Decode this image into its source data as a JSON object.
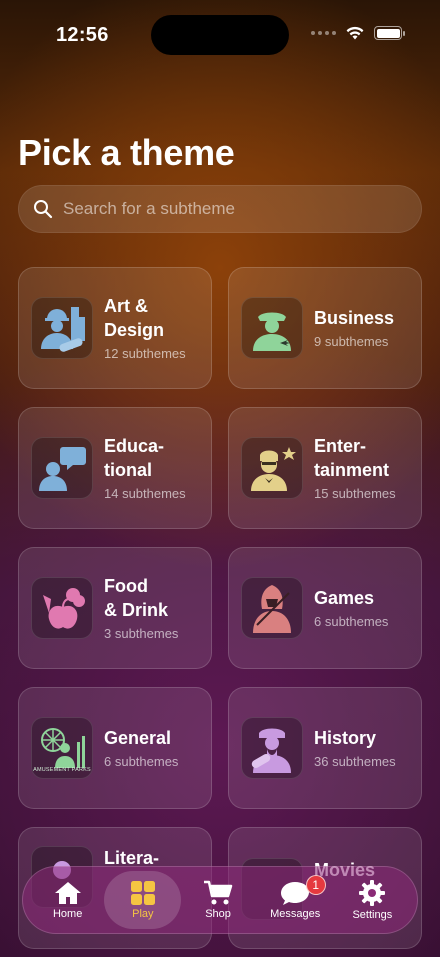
{
  "status_bar": {
    "time": "12:56"
  },
  "page_title": "Pick a theme",
  "search": {
    "placeholder": "Search for a subtheme"
  },
  "themes": [
    {
      "title": "Art &\nDesign",
      "subtitle": "12 subthemes",
      "icon": "architect-icon",
      "color": "#7fb0d9"
    },
    {
      "title": "Business",
      "subtitle": "9 subthemes",
      "icon": "pilot-icon",
      "color": "#8fd49a"
    },
    {
      "title": "Educa-\ntional",
      "subtitle": "14 subthemes",
      "icon": "speaker-icon",
      "color": "#7fb0d9"
    },
    {
      "title": "Enter-\ntainment",
      "subtitle": "15 subthemes",
      "icon": "entertainer-icon",
      "color": "#e3d08a"
    },
    {
      "title": "Food\n& Drink",
      "subtitle": "3 subthemes",
      "icon": "fruit-icon",
      "color": "#e079b0"
    },
    {
      "title": "Games",
      "subtitle": "6 subthemes",
      "icon": "assassin-icon",
      "color": "#d98080"
    },
    {
      "title": "General",
      "subtitle": "6 subthemes",
      "icon": "amusement-park-icon",
      "color": "#8fd49a",
      "icon_caption": "AMUSEMENT PARKS"
    },
    {
      "title": "History",
      "subtitle": "36 subthemes",
      "icon": "historian-icon",
      "color": "#c89ae0"
    },
    {
      "title": "Litera-",
      "subtitle": "",
      "icon": "literature-icon",
      "color": "#c89ae0"
    },
    {
      "title": "Movies",
      "subtitle": "",
      "icon": "movies-icon",
      "color": "#7fb0d9"
    }
  ],
  "tabs": [
    {
      "label": "Home",
      "icon": "house-icon"
    },
    {
      "label": "Play",
      "icon": "grid-icon",
      "active": true
    },
    {
      "label": "Shop",
      "icon": "cart-icon"
    },
    {
      "label": "Messages",
      "icon": "chat-icon",
      "badge": "1"
    },
    {
      "label": "Settings",
      "icon": "gear-icon"
    }
  ],
  "colors": {
    "accent": "#f5c542",
    "badge": "#e5393f"
  }
}
